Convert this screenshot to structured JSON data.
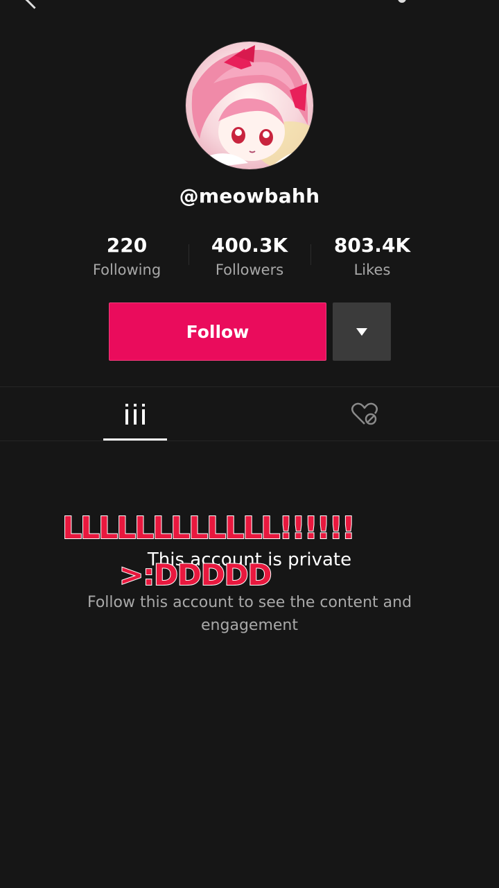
{
  "profile": {
    "username": "@meowbahh",
    "avatar_icon": "anime-avatar"
  },
  "stats": [
    {
      "value": "220",
      "label": "Following"
    },
    {
      "value": "400.3K",
      "label": "Followers"
    },
    {
      "value": "803.4K",
      "label": "Likes"
    }
  ],
  "actions": {
    "follow_label": "Follow",
    "more_icon": "caret-down-icon"
  },
  "tabs": [
    {
      "icon": "videos-grid-icon",
      "active": true
    },
    {
      "icon": "liked-hidden-icon",
      "active": false
    }
  ],
  "private_notice": {
    "title": "This account is private",
    "description": "Follow this account to see the content and engagement"
  },
  "overlay": {
    "line1": "LLLLLLLLLLLL!!!!!!",
    "line2": ">:DDDDD"
  },
  "colors": {
    "background": "#161616",
    "follow_button": "#ea0c5c",
    "overlay_text": "#e8183e"
  }
}
